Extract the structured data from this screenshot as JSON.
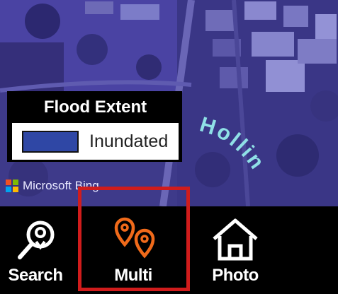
{
  "legend": {
    "title": "Flood Extent",
    "items": [
      {
        "label": "Inundated",
        "color": "#2f47a5"
      }
    ]
  },
  "map": {
    "attribution": "Microsoft Bing",
    "street_label": "Hollin"
  },
  "toolbar": {
    "items": [
      {
        "label": "Search",
        "icon": "search-pin-icon"
      },
      {
        "label": "Multi",
        "icon": "multi-pin-icon",
        "selected": true
      },
      {
        "label": "Photo",
        "icon": "home-icon"
      }
    ]
  },
  "colors": {
    "map_tint": "#4b3fa0",
    "accent_orange": "#f06a1a",
    "highlight_red": "#d01c1c",
    "toolbar_bg": "#000000"
  }
}
